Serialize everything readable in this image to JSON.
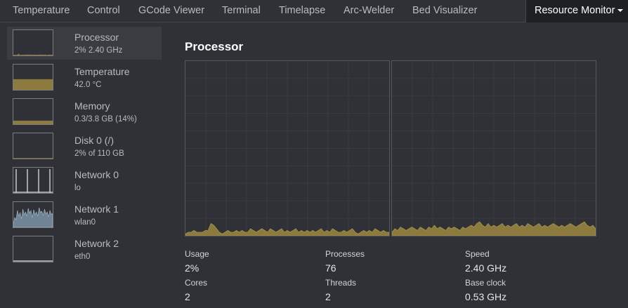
{
  "tabs": [
    {
      "label": "Temperature",
      "active": false
    },
    {
      "label": "Control",
      "active": false
    },
    {
      "label": "GCode Viewer",
      "active": false
    },
    {
      "label": "Terminal",
      "active": false
    },
    {
      "label": "Timelapse",
      "active": false
    },
    {
      "label": "Arc-Welder",
      "active": false
    },
    {
      "label": "Bed Visualizer",
      "active": false
    },
    {
      "label": "Resource Monitor",
      "active": true,
      "has_dropdown": true
    }
  ],
  "sidebar": {
    "items": [
      {
        "name": "Processor",
        "value": "2% 2.40 GHz",
        "selected": true,
        "color": "#8c7a3e",
        "level": 0.04
      },
      {
        "name": "Temperature",
        "value": "42.0 °C",
        "selected": false,
        "color": "#8c7a3e",
        "level": 0.42
      },
      {
        "name": "Memory",
        "value": "0.3/3.8 GB (14%)",
        "selected": false,
        "color": "#8c7a3e",
        "level": 0.14
      },
      {
        "name": "Disk 0 (/)",
        "value": "2% of 110 GB",
        "selected": false,
        "color": "#8c7a3e",
        "level": 0.02
      },
      {
        "name": "Network 0",
        "value": "lo",
        "selected": false,
        "color": "#b7c2cc"
      },
      {
        "name": "Network 1",
        "value": "wlan0",
        "selected": false,
        "color": "#6f8595"
      },
      {
        "name": "Network 2",
        "value": "eth0",
        "selected": false,
        "color": "#b7c2cc"
      }
    ]
  },
  "panel": {
    "title": "Processor",
    "graph_color": "#8c7a3e",
    "stats": [
      {
        "label": "Usage",
        "value": "2%"
      },
      {
        "label": "Processes",
        "value": "76"
      },
      {
        "label": "Speed",
        "value": "2.40 GHz"
      },
      {
        "label": "Cores",
        "value": "2"
      },
      {
        "label": "Threads",
        "value": "2"
      },
      {
        "label": "Base clock",
        "value": "0.53 GHz"
      }
    ],
    "core_usage": [
      [
        1,
        2,
        2,
        3,
        2,
        2,
        2,
        3,
        3,
        7,
        6,
        4,
        2,
        1,
        2,
        3,
        2,
        2,
        3,
        2,
        3,
        2,
        2,
        4,
        3,
        2,
        3,
        4,
        3,
        2,
        4,
        3,
        2,
        3,
        4,
        2,
        3,
        2,
        3,
        4,
        2,
        3,
        2,
        3,
        2,
        3,
        2,
        3,
        4,
        2,
        3,
        2,
        4,
        3,
        2,
        2,
        3,
        2,
        3,
        4,
        2,
        1,
        2,
        3,
        2,
        3,
        2,
        4,
        3,
        2,
        3,
        2,
        2
      ],
      [
        2,
        4,
        3,
        5,
        4,
        3,
        4,
        5,
        4,
        3,
        5,
        4,
        3,
        5,
        4,
        6,
        4,
        5,
        4,
        3,
        5,
        4,
        5,
        4,
        3,
        5,
        4,
        5,
        6,
        5,
        7,
        8,
        6,
        5,
        7,
        5,
        6,
        5,
        6,
        7,
        5,
        6,
        5,
        6,
        7,
        5,
        6,
        5,
        7,
        6,
        5,
        6,
        7,
        5,
        6,
        5,
        6,
        7,
        6,
        5,
        6,
        5,
        6,
        7,
        6,
        5,
        6,
        7,
        8,
        6,
        5,
        6,
        4
      ]
    ],
    "network_traffic": {
      "lo": [
        0,
        0,
        0,
        0,
        0,
        0,
        0,
        0,
        0,
        0,
        0,
        0,
        0,
        0,
        0,
        0,
        0,
        0,
        0,
        0,
        0,
        0,
        0,
        0,
        0,
        0,
        0,
        0,
        0,
        0,
        0,
        0,
        0,
        0,
        0,
        0,
        0,
        0,
        0,
        0,
        0,
        0,
        0,
        0,
        0,
        0,
        0,
        0,
        0,
        0,
        0,
        0,
        0,
        0,
        0,
        0,
        0,
        0,
        0,
        0
      ],
      "wlan0": [
        0,
        0,
        0,
        0,
        0,
        0,
        0,
        0,
        0,
        0,
        0,
        0,
        0,
        0,
        0,
        0,
        0,
        0,
        0,
        0,
        0,
        0,
        0,
        0,
        0,
        0,
        0,
        0,
        0,
        0,
        0,
        0,
        0,
        0,
        0,
        0,
        0,
        0,
        0,
        0,
        0,
        0,
        0,
        0,
        0,
        0,
        0,
        0,
        0,
        0,
        0,
        0,
        0,
        0,
        0,
        0,
        0,
        0,
        0,
        0
      ],
      "eth0": [
        0,
        0,
        0,
        0,
        0,
        0,
        0,
        0,
        0,
        0,
        0,
        0,
        0,
        0,
        0,
        0,
        0,
        0,
        0,
        0,
        0,
        0,
        0,
        0,
        0,
        0,
        0,
        0,
        0,
        0,
        0,
        0,
        0,
        0,
        0,
        0,
        0,
        0,
        0,
        0,
        0,
        0,
        0,
        0,
        0,
        0,
        0,
        0,
        0,
        0,
        0,
        0,
        0,
        0,
        0,
        0,
        0,
        0,
        0,
        0
      ]
    }
  }
}
